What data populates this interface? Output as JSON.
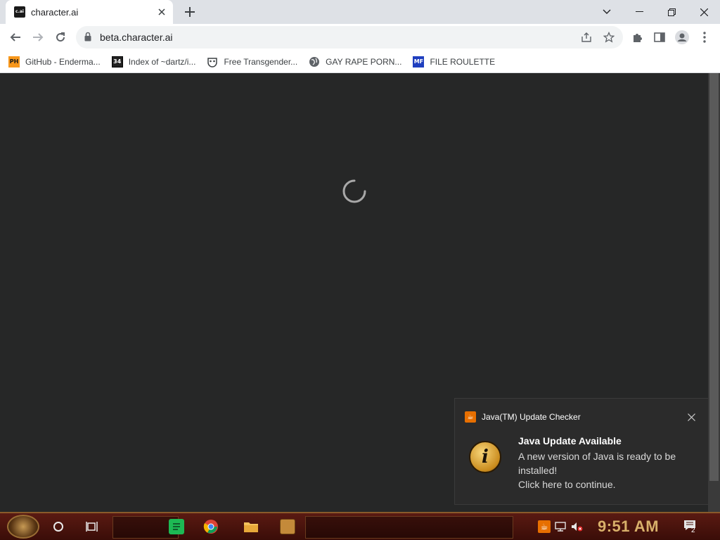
{
  "browser": {
    "tab": {
      "favicon_text": "c.ai",
      "title": "character.ai"
    },
    "url": "beta.character.ai",
    "bookmarks": [
      {
        "label": "GitHub - Enderma...",
        "icon": "ph-icon",
        "icon_text": "PH"
      },
      {
        "label": "Index of ~dartz/i...",
        "icon": "grid-icon",
        "icon_text": "34"
      },
      {
        "label": "Free Transgender...",
        "icon": "mask-icon",
        "icon_text": ""
      },
      {
        "label": "GAY RAPE PORN...",
        "icon": "globe-icon",
        "icon_text": ""
      },
      {
        "label": "FILE ROULETTE",
        "icon": "roulette-icon",
        "icon_text": "MF"
      }
    ]
  },
  "page": {
    "state": "loading"
  },
  "toast": {
    "app_name": "Java(TM) Update Checker",
    "title": "Java Update Available",
    "line1": "A new version of Java is ready to be installed!",
    "line2": "Click here to continue.",
    "info_glyph": "i"
  },
  "taskbar": {
    "clock": "9:51 AM",
    "notification_count": "2"
  },
  "colors": {
    "page_bg": "#262727",
    "toast_bg": "#2b2b2b",
    "java_orange": "#e76f00",
    "taskbar": "#4a120c",
    "clock_gold": "#d8b06a"
  }
}
